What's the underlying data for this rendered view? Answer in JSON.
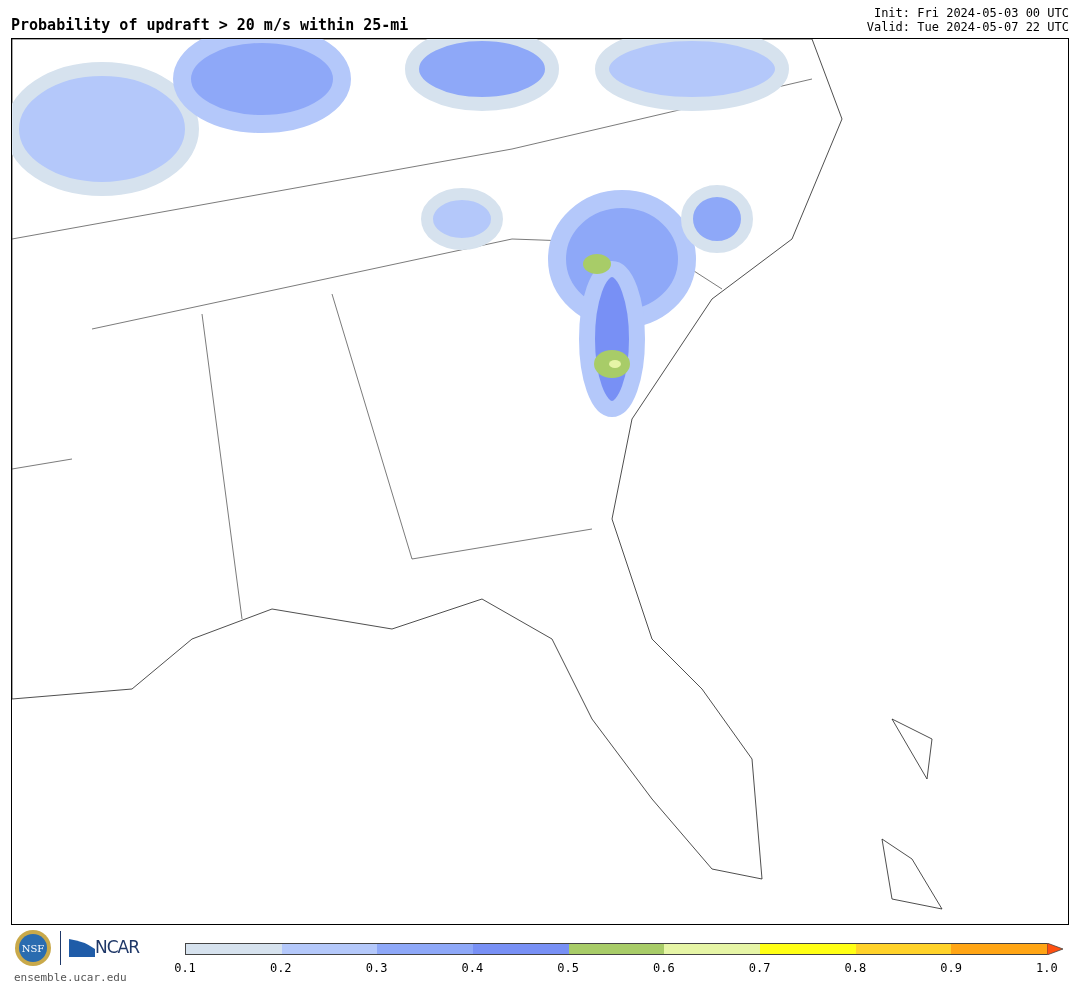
{
  "title": "Probability of updraft > 20 m/s within 25-mi",
  "init": "Init: Fri 2024-05-03 00 UTC",
  "valid": "Valid: Tue 2024-05-07 22 UTC",
  "logos": {
    "seal": "NSF",
    "brand": "NCAR",
    "site": "ensemble.ucar.edu"
  },
  "colorbar": {
    "bins": [
      {
        "kind": "swatch",
        "color": "#d6e2ee"
      },
      {
        "kind": "swatch",
        "color": "#b4c8fa"
      },
      {
        "kind": "swatch",
        "color": "#8ea8f8"
      },
      {
        "kind": "swatch",
        "color": "#7890f5"
      },
      {
        "kind": "swatch",
        "color": "#a8cc68"
      },
      {
        "kind": "swatch",
        "color": "#e6f5a6"
      },
      {
        "kind": "swatch",
        "color": "#ffff14"
      },
      {
        "kind": "swatch",
        "color": "#ffd22a"
      },
      {
        "kind": "swatch",
        "color": "#ffa514"
      },
      {
        "kind": "arrow",
        "color": "#ff5010"
      }
    ],
    "ticks": [
      "0.1",
      "0.2",
      "0.3",
      "0.4",
      "0.5",
      "0.6",
      "0.7",
      "0.8",
      "0.9",
      "1.0"
    ]
  }
}
